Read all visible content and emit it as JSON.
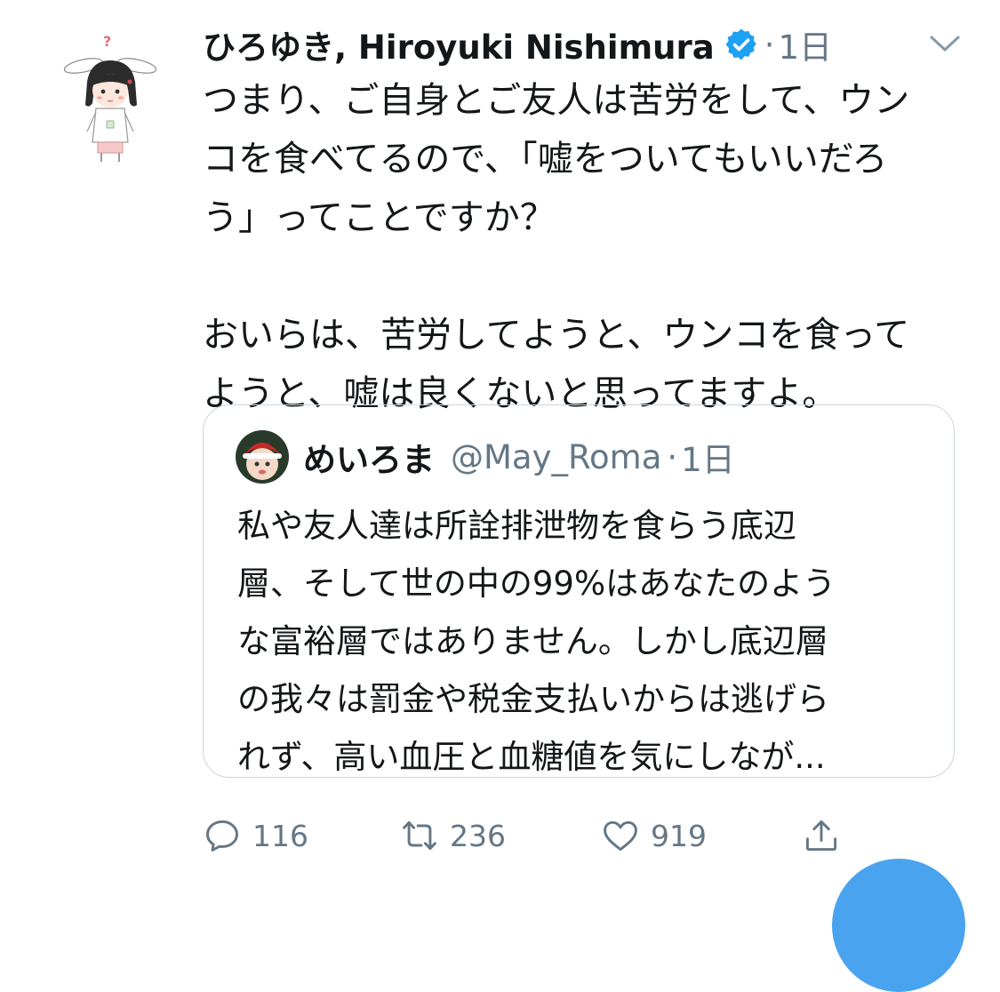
{
  "tweet": {
    "display_name": "ひろゆき, Hiroyuki Nishimura",
    "separator": "·",
    "time": "1日",
    "text": "つまり、ご自身とご友人は苦労をして、ウン\nコを食べてるので、「嘘をついてもいいだろ\nう」ってことですか？\n\nおいらは、苦労してようと、ウンコを食って\nようと、嘘は良くないと思ってますよ。",
    "verified_icon": "verified-badge-icon",
    "verified_color": "#1da1f2"
  },
  "quote": {
    "display_name": "めいろま",
    "handle": "@May_Roma",
    "separator": "·",
    "time": "1日",
    "text": "私や友人達は所詮排泄物を食らう底辺\n層、そして世の中の99%はあなたのよう\nな富裕層ではありません。しかし底辺層\nの我々は罰金や税金支払いからは逃げら\nれず、高い血圧と血糖値を気にしなが..."
  },
  "actions": {
    "reply_count": "116",
    "retweet_count": "236",
    "like_count": "919"
  },
  "colors": {
    "text": "#14171a",
    "secondary": "#657786",
    "border": "#ccd6dd",
    "accent": "#1da1f2",
    "fab": "#4aa3ee"
  }
}
